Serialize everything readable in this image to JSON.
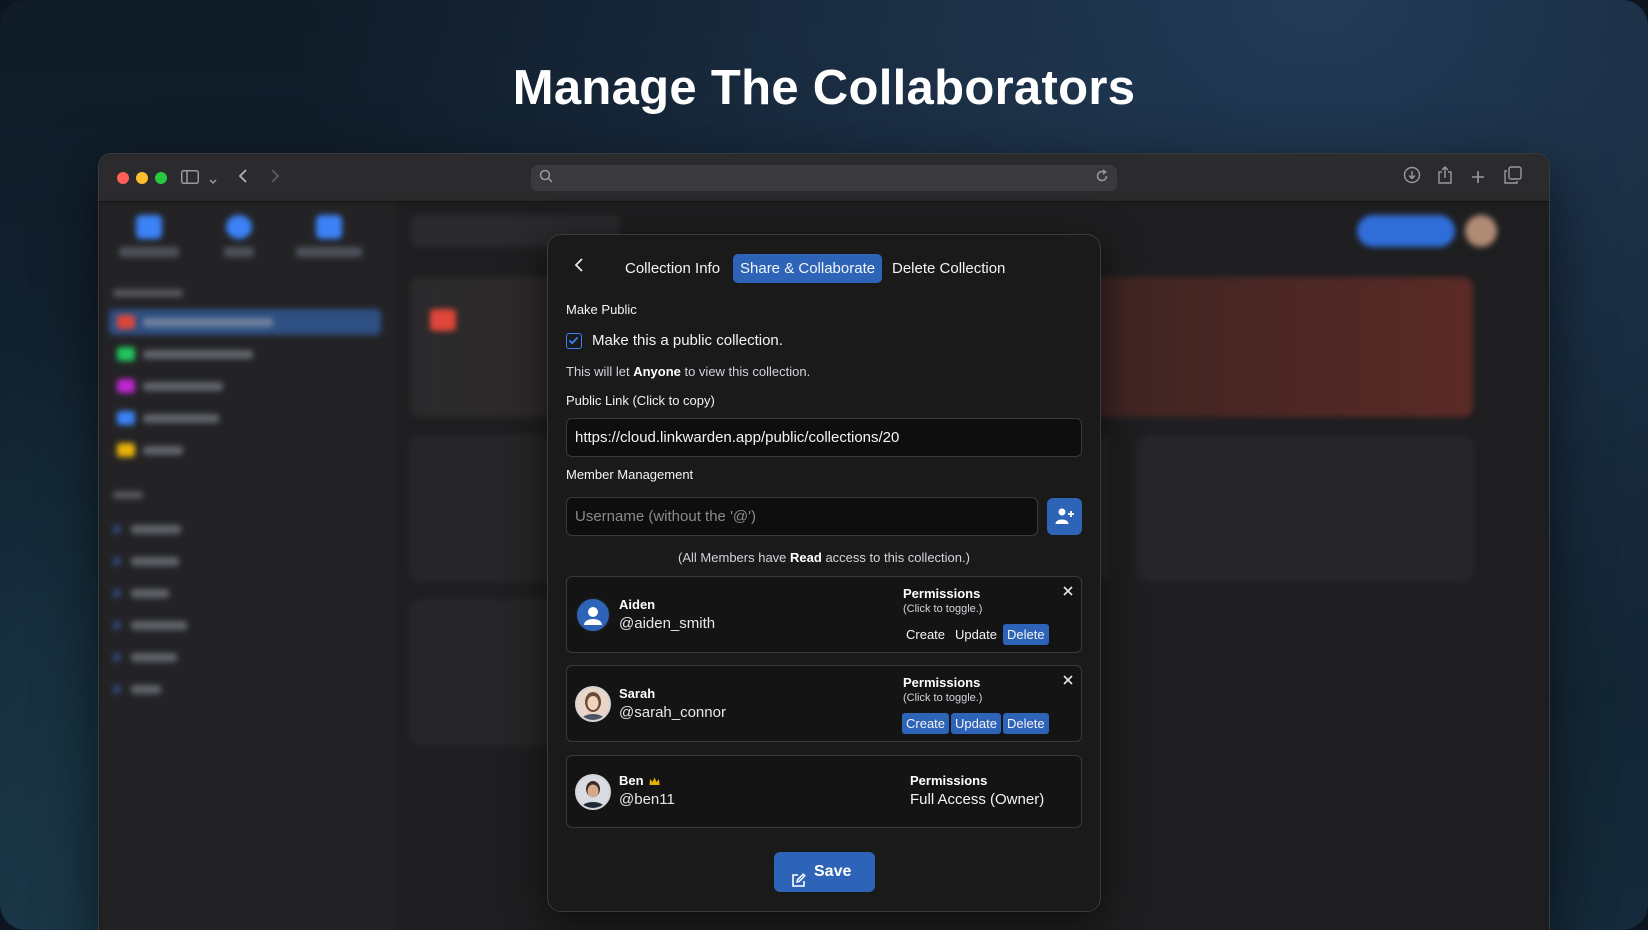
{
  "headline": "Manage The Collaborators",
  "browser": {
    "icons": [
      "sidebar-toggle-icon",
      "chevron-down-icon",
      "back-icon",
      "forward-icon",
      "search-icon",
      "reload-icon",
      "download-icon",
      "share-icon",
      "new-tab-icon",
      "tabs-overview-icon"
    ]
  },
  "modal": {
    "tabs": [
      "Collection Info",
      "Share & Collaborate",
      "Delete Collection"
    ],
    "active_tab": "Share & Collaborate",
    "make_public_label": "Make Public",
    "public_checkbox_label": "Make this a public collection.",
    "public_checked": true,
    "public_note_pre": "This will let ",
    "public_note_bold": "Anyone",
    "public_note_post": " to view this collection.",
    "public_link_label": "Public Link (Click to copy)",
    "public_link_value": "https://cloud.linkwarden.app/public/collections/20",
    "member_mgmt_label": "Member Management",
    "username_placeholder": "Username (without the '@')",
    "members_note_pre": "(All Members have ",
    "members_note_bold": "Read",
    "members_note_post": " access to this collection.)",
    "permissions_title": "Permissions",
    "permissions_hint": "(Click to toggle.)",
    "members": [
      {
        "name": "Aiden",
        "username": "@aiden_smith",
        "create": "Create",
        "update": "Update",
        "delete": "Delete",
        "create_on": false,
        "update_on": false,
        "delete_on": true
      },
      {
        "name": "Sarah",
        "username": "@sarah_connor",
        "create": "Create",
        "update": "Update",
        "delete": "Delete",
        "create_on": true,
        "update_on": true,
        "delete_on": true
      }
    ],
    "owner": {
      "name": "Ben",
      "username": "@ben11",
      "permissions_title": "Permissions",
      "permissions_value": "Full Access (Owner)"
    },
    "save_label": "Save"
  },
  "colors": {
    "accent": "#2e64b8",
    "modal_bg": "#1a1a1b",
    "crown": "#e5b100"
  }
}
